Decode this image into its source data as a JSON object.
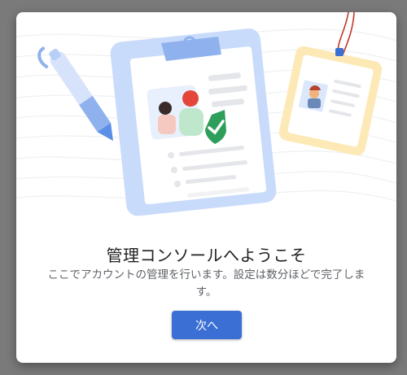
{
  "dialog": {
    "title": "管理コンソールへようこそ",
    "description": "ここでアカウントの管理を行います。設定は数分ほどで完了します。",
    "next_label": "次へ"
  },
  "colors": {
    "accent": "#3b6fd4",
    "clipboard": "#c9dbfa",
    "badge": "#fde9b6",
    "check": "#2e9e5b"
  },
  "icons": [
    "pen-icon",
    "clipboard-icon",
    "id-badge-icon",
    "checkmark-icon"
  ]
}
